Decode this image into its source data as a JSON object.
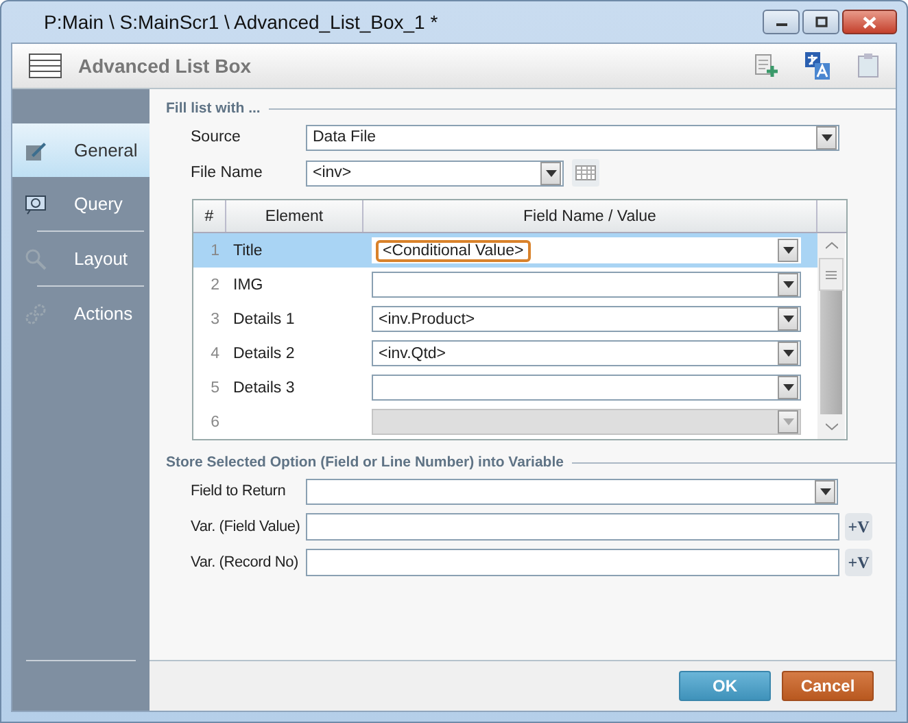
{
  "window": {
    "title": "P:Main \\ S:MainScr1 \\ Advanced_List_Box_1 *"
  },
  "header": {
    "title": "Advanced List Box"
  },
  "sidebar": {
    "items": [
      {
        "label": "General",
        "selected": true
      },
      {
        "label": "Query",
        "selected": false
      },
      {
        "label": "Layout",
        "selected": false
      },
      {
        "label": "Actions",
        "selected": false
      }
    ]
  },
  "fill_section": {
    "title": "Fill list with ...",
    "source": {
      "label": "Source",
      "value": "Data File"
    },
    "file_name": {
      "label": "File Name",
      "value": "<inv>"
    }
  },
  "table": {
    "columns": [
      "#",
      "Element",
      "Field Name / Value"
    ],
    "rows": [
      {
        "num": "1",
        "element": "Title",
        "value": "<Conditional Value>",
        "selected": true,
        "focused": true,
        "disabled": false
      },
      {
        "num": "2",
        "element": "IMG",
        "value": "",
        "selected": false,
        "focused": false,
        "disabled": false
      },
      {
        "num": "3",
        "element": "Details 1",
        "value": "<inv.Product>",
        "selected": false,
        "focused": false,
        "disabled": false
      },
      {
        "num": "4",
        "element": "Details 2",
        "value": "<inv.Qtd>",
        "selected": false,
        "focused": false,
        "disabled": false
      },
      {
        "num": "5",
        "element": "Details 3",
        "value": "",
        "selected": false,
        "focused": false,
        "disabled": false
      },
      {
        "num": "6",
        "element": "",
        "value": "",
        "selected": false,
        "focused": false,
        "disabled": true
      }
    ]
  },
  "store_section": {
    "title": "Store Selected Option (Field or Line Number) into Variable",
    "fields": [
      {
        "label": "Field to Return",
        "kind": "dropdown"
      },
      {
        "label": "Var. (Field Value)",
        "kind": "variable",
        "button": "+V"
      },
      {
        "label": "Var. (Record No)",
        "kind": "variable",
        "button": "+V"
      }
    ]
  },
  "buttons": [
    {
      "label": "OK",
      "kind": "primary"
    },
    {
      "label": "Cancel",
      "kind": "danger"
    }
  ]
}
